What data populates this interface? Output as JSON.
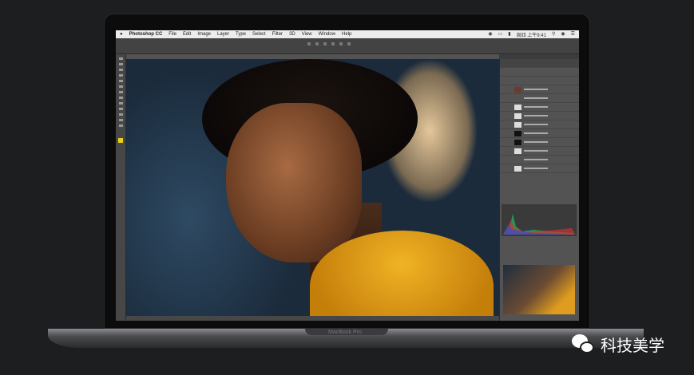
{
  "menubar": {
    "app": "Photoshop CC",
    "items": [
      "File",
      "Edit",
      "Image",
      "Layer",
      "Type",
      "Select",
      "Filter",
      "3D",
      "View",
      "Window",
      "Help"
    ],
    "clock": "周四 上午9:41"
  },
  "laptop": {
    "brand": "MacBook Pro"
  },
  "watermark": {
    "text": "科技美学"
  }
}
